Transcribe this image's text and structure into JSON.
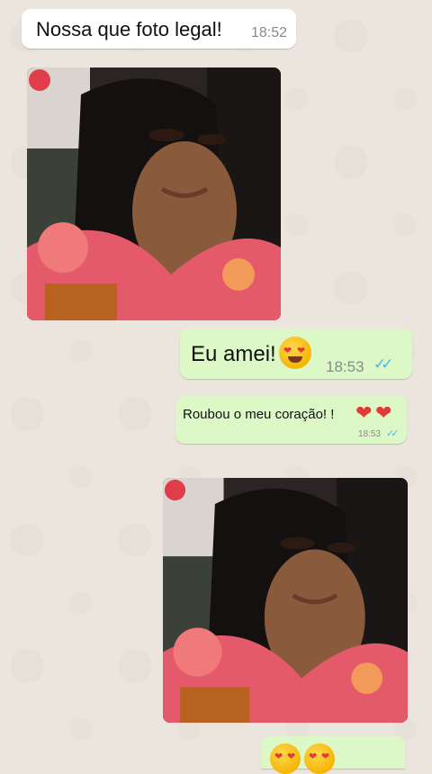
{
  "messages": [
    {
      "text": "Nossa que foto legal!",
      "time": "18:52",
      "direction": "incoming"
    },
    {
      "type": "photo",
      "direction": "incoming"
    },
    {
      "text": "Eu amei!",
      "emoji": "heart-eyes-emoji",
      "time": "18:53",
      "direction": "outgoing",
      "status": "read"
    },
    {
      "text": "Roubou o meu coração! !",
      "emoji": "red-heart-emoji x2",
      "time": "18:53",
      "direction": "outgoing",
      "status": "read"
    },
    {
      "type": "photo",
      "direction": "outgoing"
    },
    {
      "emoji": "heart-eyes-emoji x2",
      "direction": "outgoing"
    }
  ],
  "colors": {
    "wallpaper": "#ece5dd",
    "incoming_bubble": "#ffffff",
    "outgoing_bubble": "#dcf8c6",
    "read_ticks": "#4fb6ec"
  },
  "icons": {
    "read_ticks": "✓✓",
    "heart": "❤"
  }
}
